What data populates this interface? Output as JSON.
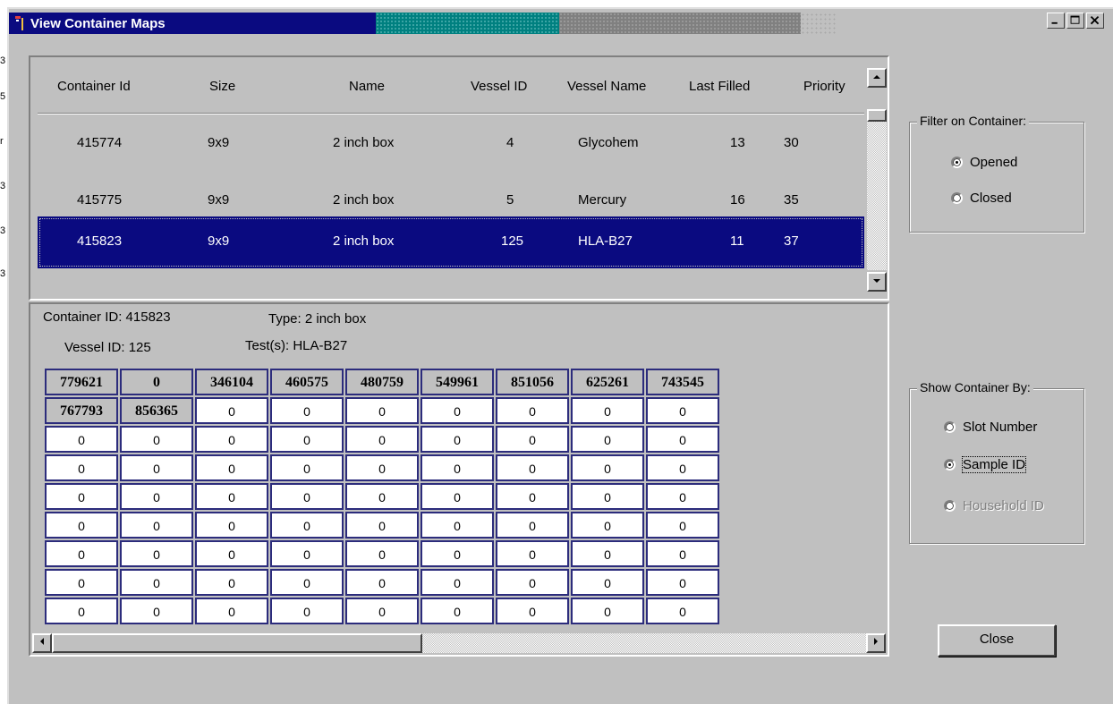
{
  "window": {
    "title": "View Container Maps",
    "controls": {
      "minimize": "_",
      "maximize": "□",
      "close": "×"
    }
  },
  "left_strip": [
    "3",
    "5",
    "r",
    "3",
    "3",
    "3"
  ],
  "container_table": {
    "columns": [
      "Container Id",
      "Size",
      "Name",
      "Vessel ID",
      "Vessel Name",
      "Last Filled",
      "Priority"
    ],
    "rows": [
      [
        "415774",
        "9x9",
        "2 inch box",
        "4",
        "Glycohem",
        "13",
        "30"
      ],
      [
        "415775",
        "9x9",
        "2 inch box",
        "5",
        "Mercury",
        "16",
        "35"
      ],
      [
        "415823",
        "9x9",
        "2 inch box",
        "125",
        "HLA-B27",
        "11",
        "37"
      ]
    ],
    "selected_row": 2
  },
  "details": {
    "container_id": "Container ID: 415823",
    "type": "Type: 2 inch box",
    "vessel_id": "Vessel ID: 125",
    "tests": "Test(s): HLA-B27"
  },
  "map_grid": {
    "rows": [
      [
        "779621",
        "0",
        "346104",
        "460575",
        "480759",
        "549961",
        "851056",
        "625261",
        "743545"
      ],
      [
        "767793",
        "856365",
        "0",
        "0",
        "0",
        "0",
        "0",
        "0",
        "0"
      ],
      [
        "0",
        "0",
        "0",
        "0",
        "0",
        "0",
        "0",
        "0",
        "0"
      ],
      [
        "0",
        "0",
        "0",
        "0",
        "0",
        "0",
        "0",
        "0",
        "0"
      ],
      [
        "0",
        "0",
        "0",
        "0",
        "0",
        "0",
        "0",
        "0",
        "0"
      ],
      [
        "0",
        "0",
        "0",
        "0",
        "0",
        "0",
        "0",
        "0",
        "0"
      ],
      [
        "0",
        "0",
        "0",
        "0",
        "0",
        "0",
        "0",
        "0",
        "0"
      ],
      [
        "0",
        "0",
        "0",
        "0",
        "0",
        "0",
        "0",
        "0",
        "0"
      ],
      [
        "0",
        "0",
        "0",
        "0",
        "0",
        "0",
        "0",
        "0",
        "0"
      ]
    ],
    "filled_cells": [
      [
        0,
        0
      ],
      [
        0,
        1
      ],
      [
        0,
        2
      ],
      [
        0,
        3
      ],
      [
        0,
        4
      ],
      [
        0,
        5
      ],
      [
        0,
        6
      ],
      [
        0,
        7
      ],
      [
        0,
        8
      ],
      [
        1,
        0
      ],
      [
        1,
        1
      ]
    ]
  },
  "filter_group": {
    "label": "Filter on Container:",
    "options": [
      "Opened",
      "Closed"
    ],
    "selected": "Opened"
  },
  "show_by_group": {
    "label": "Show Container By:",
    "options": [
      "Slot Number",
      "Sample ID",
      "Household ID"
    ],
    "selected": "Sample ID",
    "disabled": [
      "Household ID"
    ]
  },
  "close_button": "Close",
  "colors": {
    "title_bar": "#0a0a80",
    "selection": "#0a0a80",
    "face": "#c0c0c0",
    "cell_border": "#2c2c7c"
  }
}
